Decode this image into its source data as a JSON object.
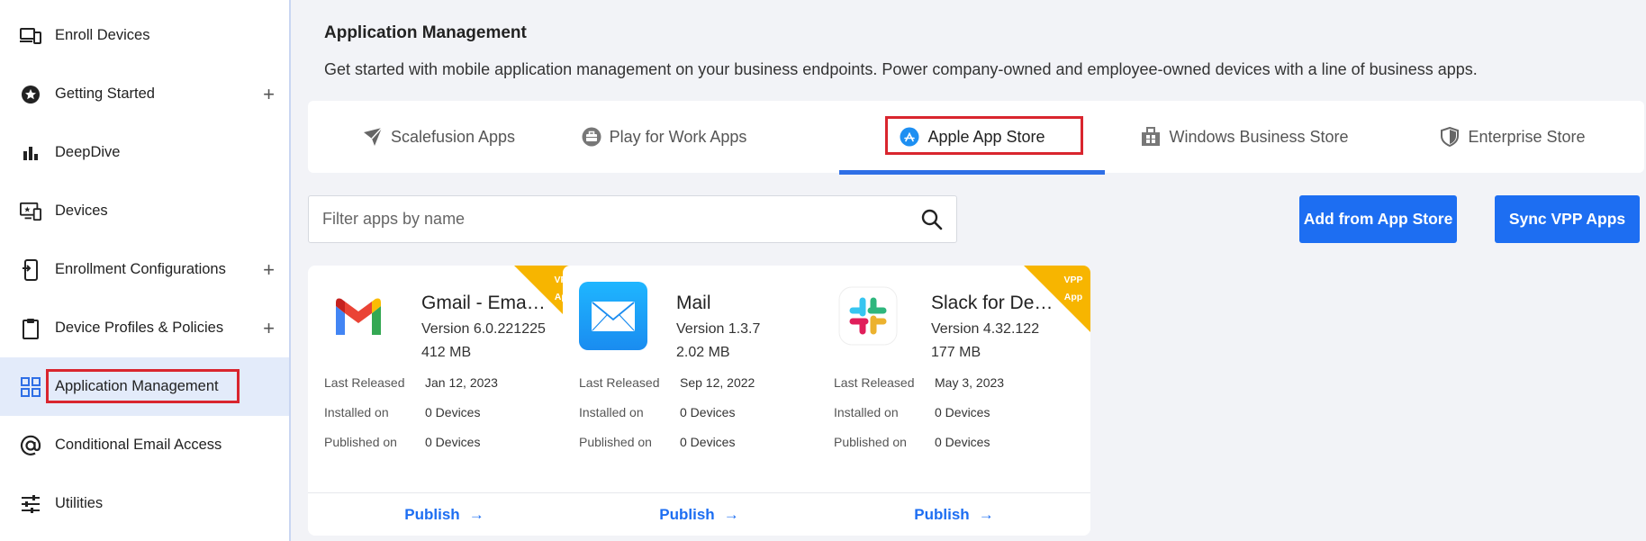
{
  "sidebar": {
    "items": [
      {
        "label": "Enroll Devices",
        "icon": "devices-icon",
        "expandable": false
      },
      {
        "label": "Getting Started",
        "icon": "star-badge-icon",
        "expandable": true
      },
      {
        "label": "DeepDive",
        "icon": "bar-chart-icon",
        "expandable": false
      },
      {
        "label": "Devices",
        "icon": "monitor-icon",
        "expandable": false
      },
      {
        "label": "Enrollment Configurations",
        "icon": "phone-enroll-icon",
        "expandable": true
      },
      {
        "label": "Device Profiles & Policies",
        "icon": "clipboard-icon",
        "expandable": true
      },
      {
        "label": "Application Management",
        "icon": "grid-icon",
        "expandable": false,
        "active": true
      },
      {
        "label": "Conditional Email Access",
        "icon": "at-icon",
        "expandable": false
      },
      {
        "label": "Utilities",
        "icon": "sliders-icon",
        "expandable": false
      }
    ],
    "plus": "+"
  },
  "header": {
    "title": "Application Management",
    "subtitle": "Get started with mobile application management on your business endpoints. Power company-owned and employee-owned devices with a line of business apps."
  },
  "tabs": [
    {
      "label": "Scalefusion Apps",
      "icon": "scalefusion-icon"
    },
    {
      "label": "Play for Work Apps",
      "icon": "briefcase-icon"
    },
    {
      "label": "Apple App Store",
      "icon": "app-store-icon",
      "active": true
    },
    {
      "label": "Windows Business Store",
      "icon": "store-bag-icon"
    },
    {
      "label": "Enterprise Store",
      "icon": "shield-icon"
    }
  ],
  "filter": {
    "placeholder": "Filter apps by name"
  },
  "buttons": {
    "add": "Add from App Store",
    "sync": "Sync VPP Apps"
  },
  "card_labels": {
    "last_released": "Last Released",
    "installed_on": "Installed on",
    "published_on": "Published on",
    "publish": "Publish",
    "arrow": "→"
  },
  "ribbon": {
    "line1": "VPP",
    "line2": "App"
  },
  "apps": [
    {
      "name": "Gmail - Email by Google",
      "version": "Version 6.0.221225",
      "size": "412 MB",
      "last_released": "Jan 12, 2023",
      "installed_on": "0 Devices",
      "published_on": "0 Devices",
      "vpp": true,
      "icon": "gmail-icon"
    },
    {
      "name": "Mail",
      "version": "Version 1.3.7",
      "size": "2.02 MB",
      "last_released": "Sep 12, 2022",
      "installed_on": "0 Devices",
      "published_on": "0 Devices",
      "vpp": false,
      "icon": "mail-icon"
    },
    {
      "name": "Slack for Desktop",
      "version": "Version 4.32.122",
      "size": "177 MB",
      "last_released": "May 3, 2023",
      "installed_on": "0 Devices",
      "published_on": "0 Devices",
      "vpp": true,
      "icon": "slack-icon"
    }
  ],
  "colors": {
    "accent": "#1d6ef2",
    "highlight": "#d9252e",
    "vpp": "#f7b500",
    "active_bg": "#e3ebfa"
  }
}
